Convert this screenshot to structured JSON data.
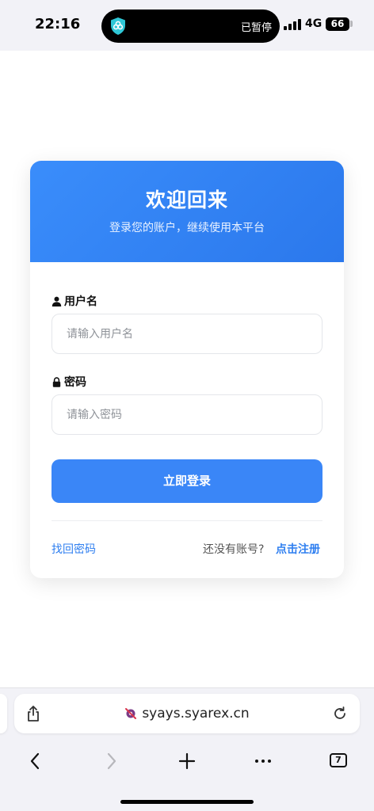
{
  "status_bar": {
    "time": "22:16",
    "vpn_icon": "vpn-shield-icon",
    "paused_text": "已暂停",
    "network": "4G",
    "battery": "66",
    "battery_level": 0.66
  },
  "card": {
    "title": "欢迎回来",
    "subtitle": "登录您的账户，继续使用本平台",
    "accent_color": "#3a86f7",
    "username": {
      "label": "用户名",
      "icon": "user-icon",
      "placeholder": "请输入用户名",
      "value": ""
    },
    "password": {
      "label": "密码",
      "icon": "lock-icon",
      "placeholder": "请输入密码",
      "value": ""
    },
    "login_button": "立即登录",
    "forgot_link": "找回密码",
    "no_account": "还没有账号?",
    "register_link": "点击注册"
  },
  "browser": {
    "url": "syays.syarex.cn",
    "share_icon": "share-icon",
    "privacy_icon": "privacy-icon",
    "reload_icon": "reload-icon",
    "tab_count": "7",
    "toolbar_icons": [
      "back-icon",
      "forward-icon",
      "plus-icon",
      "more-icon",
      "tabs-icon"
    ]
  }
}
